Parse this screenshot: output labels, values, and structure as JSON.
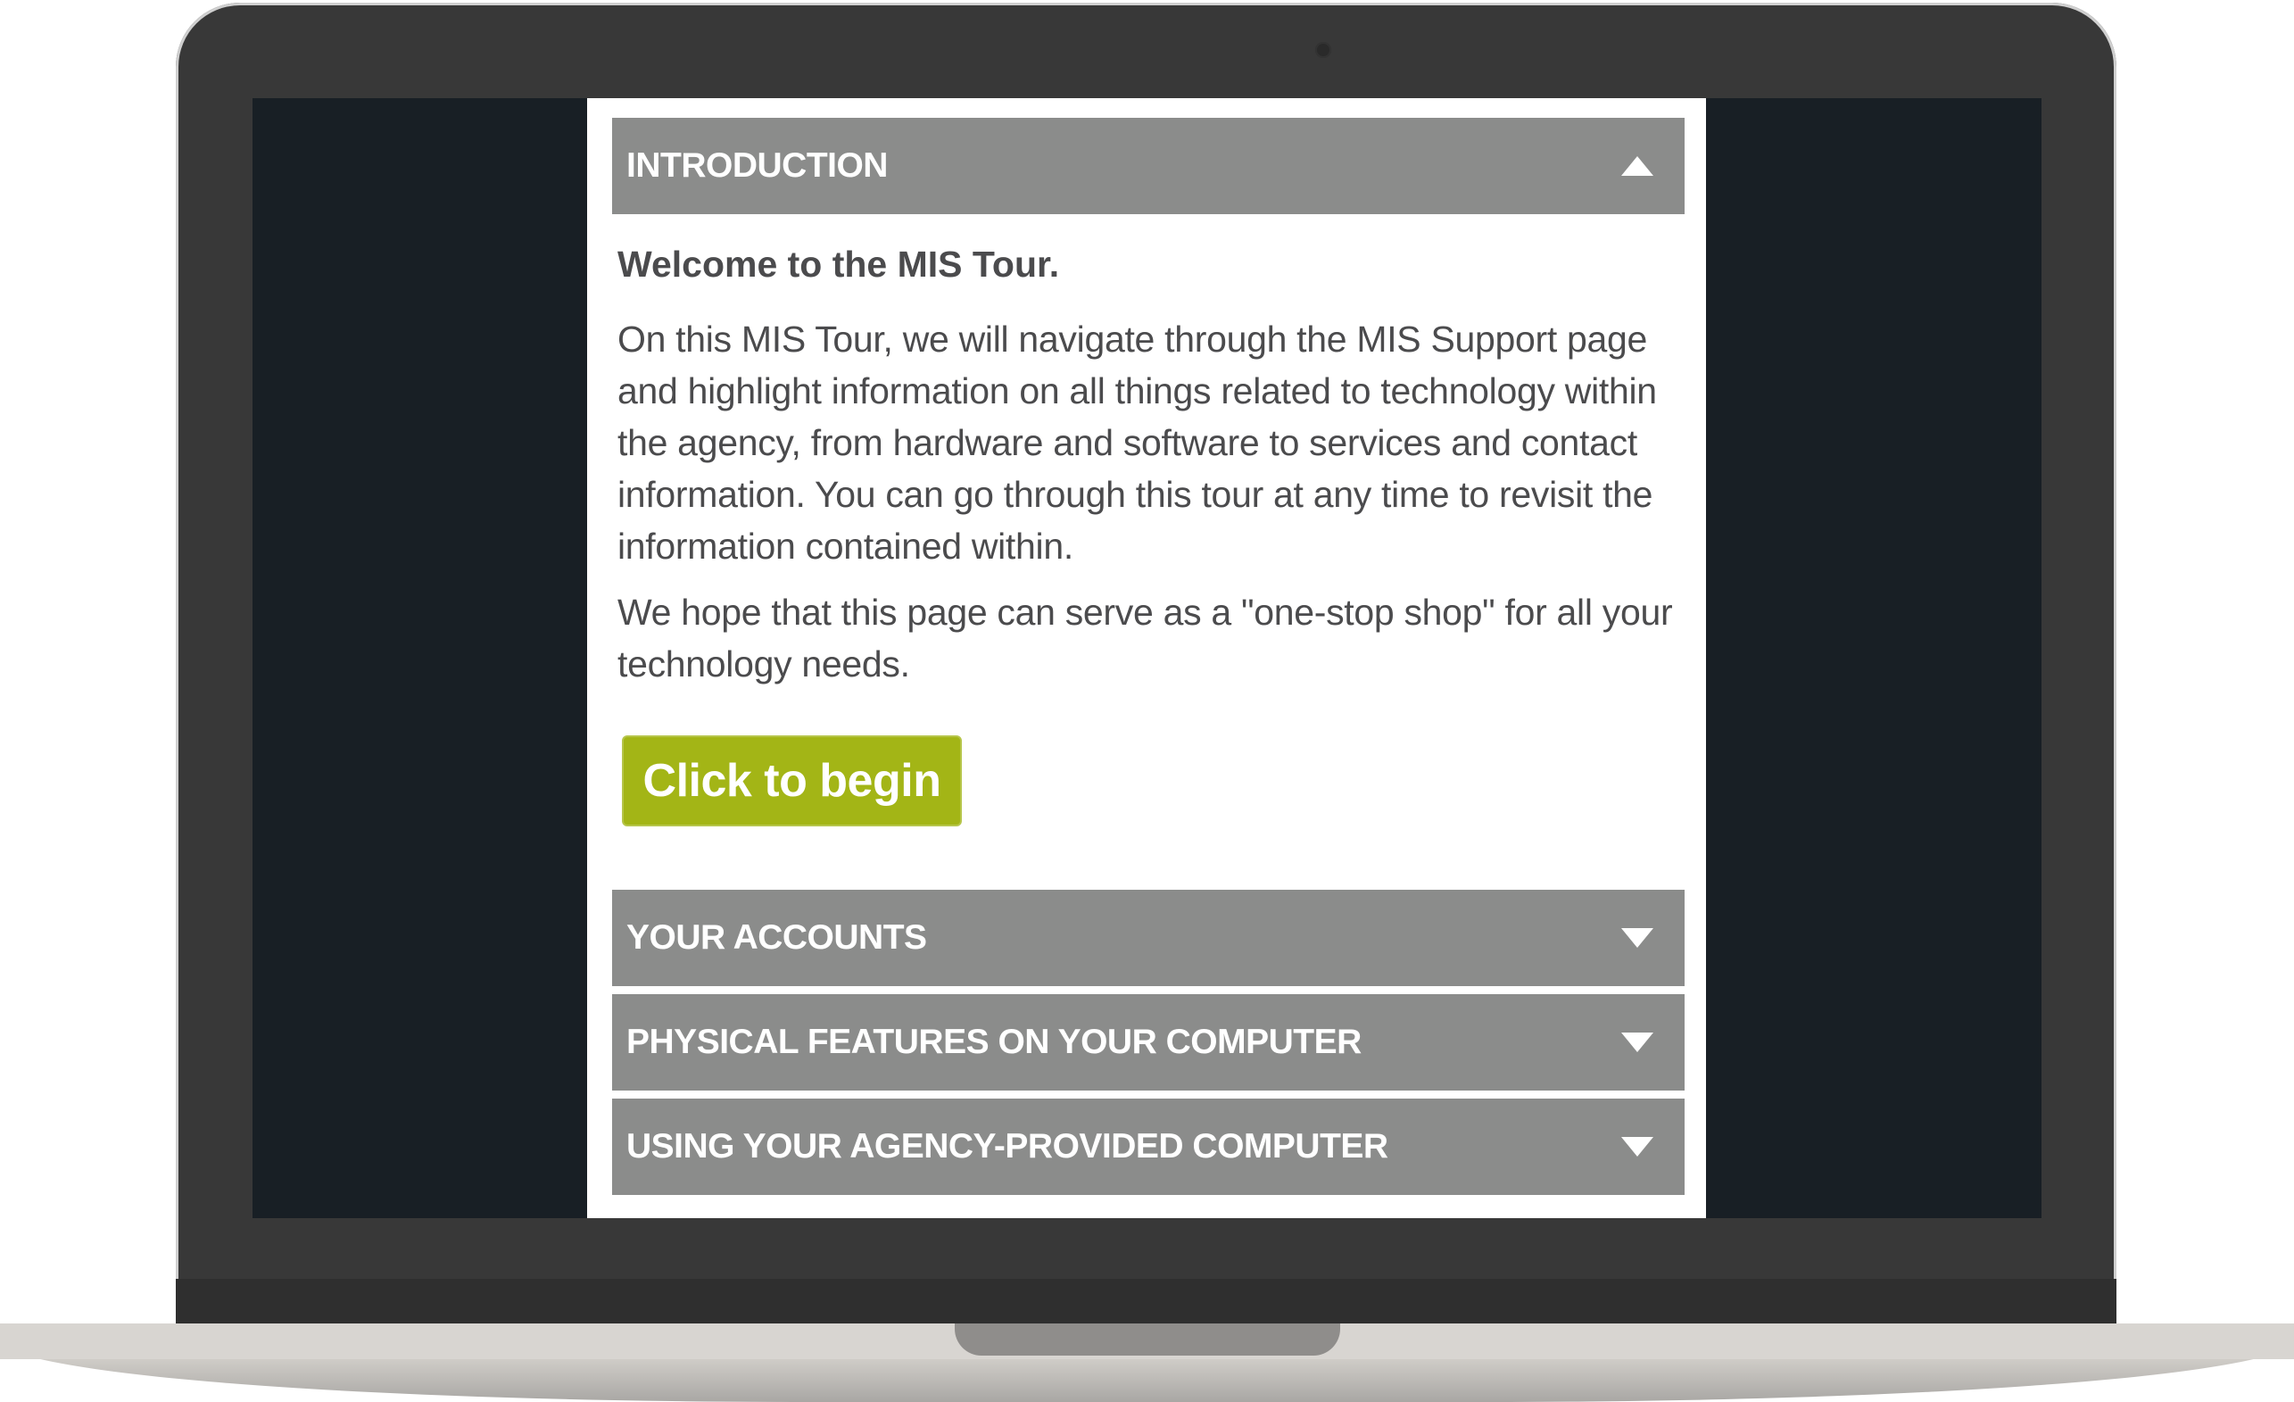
{
  "tour": {
    "sections": [
      {
        "title": "INTRODUCTION",
        "expanded": true,
        "icon": "chevron-up-icon"
      },
      {
        "title": "YOUR ACCOUNTS",
        "expanded": false,
        "icon": "chevron-down-icon"
      },
      {
        "title": "PHYSICAL FEATURES ON YOUR COMPUTER",
        "expanded": false,
        "icon": "chevron-down-icon"
      },
      {
        "title": "USING YOUR AGENCY-PROVIDED COMPUTER",
        "expanded": false,
        "icon": "chevron-down-icon"
      }
    ],
    "intro": {
      "heading": "Welcome to the MIS Tour.",
      "paragraph_1": "On this MIS Tour, we will navigate through the MIS Support page and highlight information on all things related to technology within the agency, from hardware and software to services and contact information. You can go through this tour at any time to revisit the information contained within.",
      "paragraph_2": "We hope that this page can serve as a \"one-stop shop\" for all your technology needs.",
      "button_label": "Click to begin"
    }
  },
  "colors": {
    "accordion_header": "#8b8c8b",
    "button_green": "#a3b516",
    "body_text": "#4b4b4d",
    "screen_background": "#181f25",
    "laptop_frame": "#383838"
  }
}
